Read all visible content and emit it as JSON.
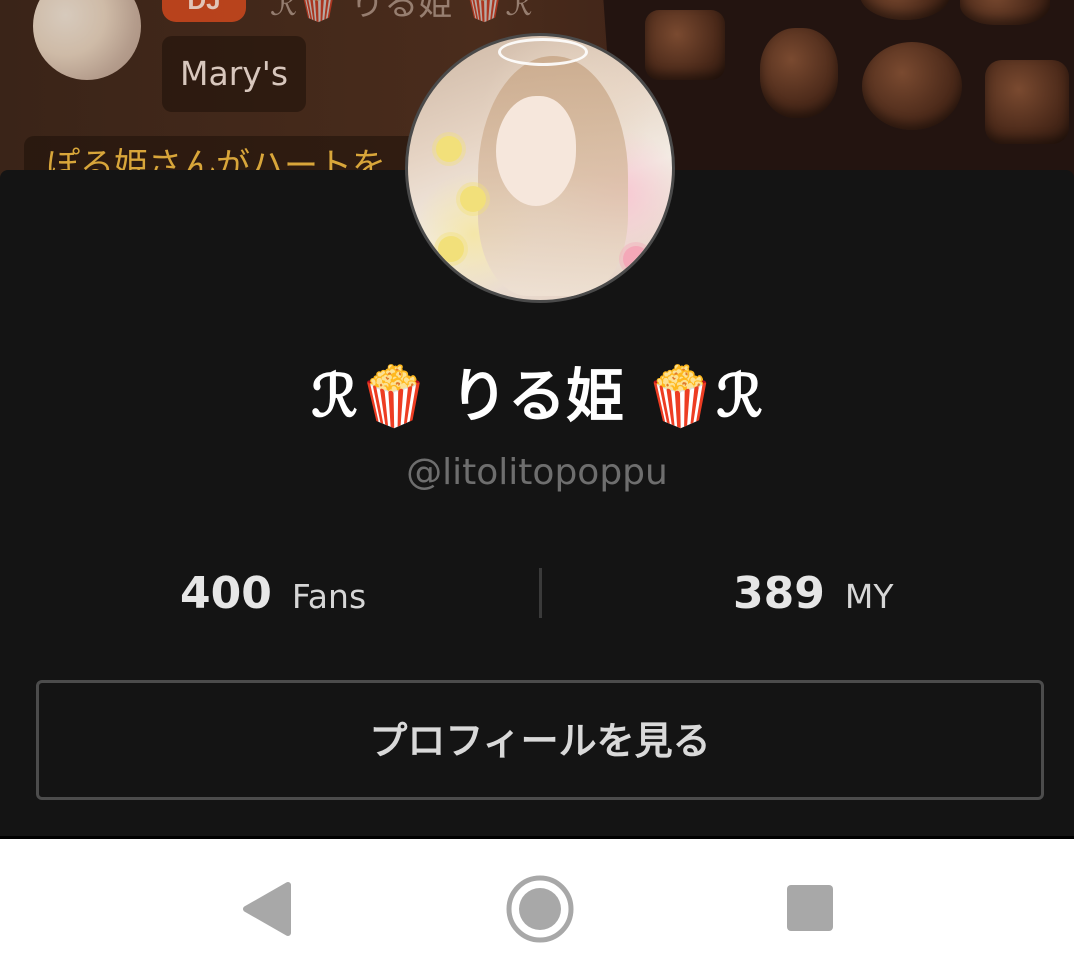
{
  "background": {
    "dj_badge": "DJ",
    "host_name": "ℛ🍿 りる姫 🍿ℛ",
    "room_tag": "Mary's",
    "comment_preview": "ぽる姫さんがハートを"
  },
  "profile_sheet": {
    "display_name": "ℛ🍿 りる姫 🍿ℛ",
    "handle": "@litolitopoppu",
    "stats": {
      "fans_count": "400",
      "fans_label": "Fans",
      "my_count": "389",
      "my_label": "MY"
    },
    "view_profile_button": "プロフィールを見る"
  },
  "nav_bar": {
    "back_icon": "back-triangle-icon",
    "home_icon": "home-circle-icon",
    "recents_icon": "recents-square-icon"
  },
  "colors": {
    "sheet_bg": "#141414",
    "dj_badge": "#c5461d",
    "comment_text": "#d9a63a",
    "handle_text": "#6e6e6e",
    "nav_icon": "#a8a8a8"
  }
}
